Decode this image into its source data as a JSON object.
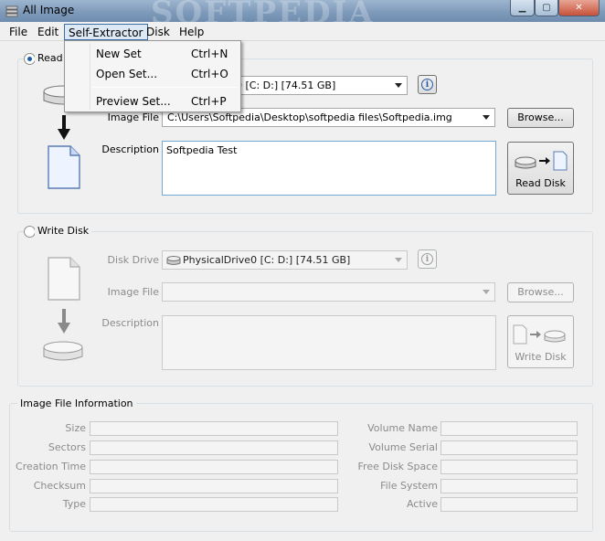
{
  "window": {
    "title": "All Image",
    "watermark": "SOFTPEDIA"
  },
  "menubar": {
    "items": [
      "File",
      "Edit",
      "Self-Extractor",
      "Disk",
      "Help"
    ]
  },
  "dropdown": {
    "items": [
      {
        "label": "New Set",
        "shortcut": "Ctrl+N"
      },
      {
        "label": "Open Set...",
        "shortcut": "Ctrl+O"
      },
      {
        "label": "Preview Set...",
        "shortcut": "Ctrl+P"
      }
    ]
  },
  "read": {
    "title": "Read",
    "disk_drive_value": "0 [C: D:] [74.51 GB]",
    "image_file_label": "Image File",
    "image_file_value": "C:\\Users\\Softpedia\\Desktop\\softpedia files\\Softpedia.img",
    "description_label": "Description",
    "description_value": "Softpedia Test",
    "browse_label": "Browse...",
    "action_label": "Read Disk"
  },
  "write": {
    "title": "Write Disk",
    "disk_drive_label": "Disk Drive",
    "disk_drive_value": "PhysicalDrive0 [C: D:] [74.51 GB]",
    "image_file_label": "Image File",
    "description_label": "Description",
    "browse_label": "Browse...",
    "action_label": "Write Disk"
  },
  "info": {
    "title": "Image File Information",
    "left_labels": [
      "Size",
      "Sectors",
      "Creation Time",
      "Checksum",
      "Type"
    ],
    "right_labels": [
      "Volume Name",
      "Volume Serial",
      "Free Disk Space",
      "File System",
      "Active"
    ]
  },
  "colors": {
    "accent": "#3d6fa5",
    "disabled_text": "#8b8b8b"
  }
}
